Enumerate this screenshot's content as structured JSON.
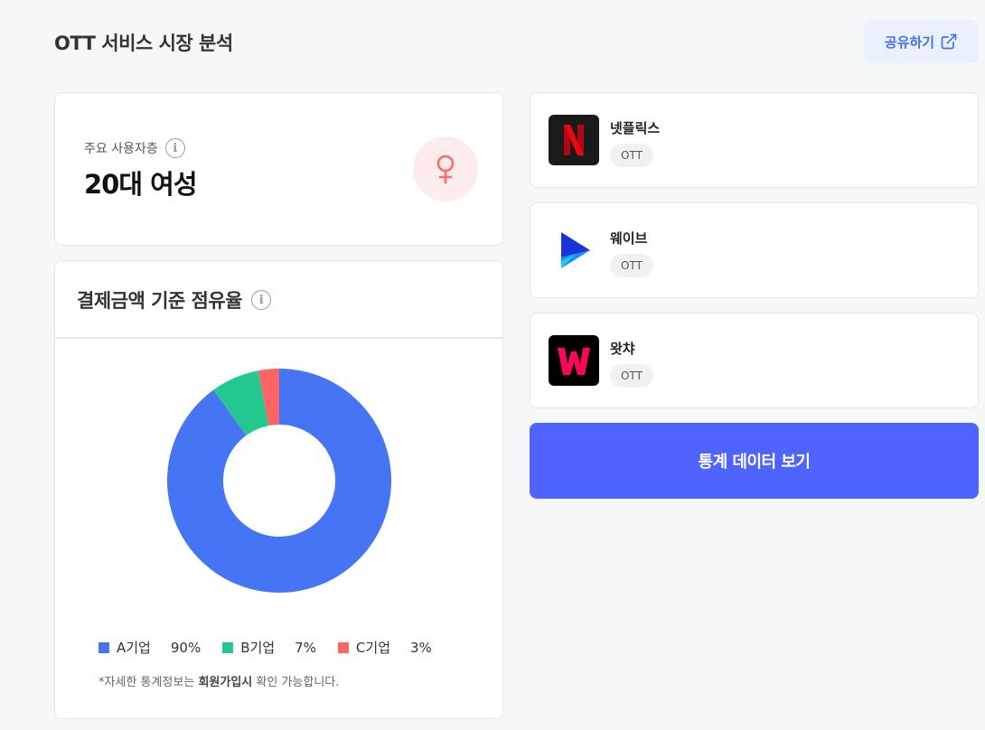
{
  "page": {
    "title": "OTT 서비스 시장 분석"
  },
  "share_button": {
    "label": "공유하기",
    "icon": "external-link-icon"
  },
  "user_card": {
    "label": "주요 사용자층",
    "value": "20대 여성",
    "icon": "female-icon",
    "accent": "#ff6b6b"
  },
  "share_card": {
    "title": "결제금액 기준 점유율",
    "note_prefix": "*자세한 통계정보는 ",
    "note_bold": "회원가입시",
    "note_suffix": " 확인 가능합니다."
  },
  "chart_data": {
    "type": "pie",
    "style": "donut",
    "categories": [
      "A기업",
      "B기업",
      "C기업"
    ],
    "values": [
      90,
      7,
      3
    ],
    "value_labels": [
      "90%",
      "7%",
      "3%"
    ],
    "colors": [
      "#4574f5",
      "#22c88f",
      "#ff6464"
    ]
  },
  "apps": [
    {
      "name": "넷플릭스",
      "tag": "OTT",
      "logo": "netflix-logo"
    },
    {
      "name": "웨이브",
      "tag": "OTT",
      "logo": "wavve-logo"
    },
    {
      "name": "왓챠",
      "tag": "OTT",
      "logo": "watcha-logo"
    }
  ],
  "stats_button": {
    "label": "통계 데이터 보기",
    "color": "#4f63ff"
  }
}
